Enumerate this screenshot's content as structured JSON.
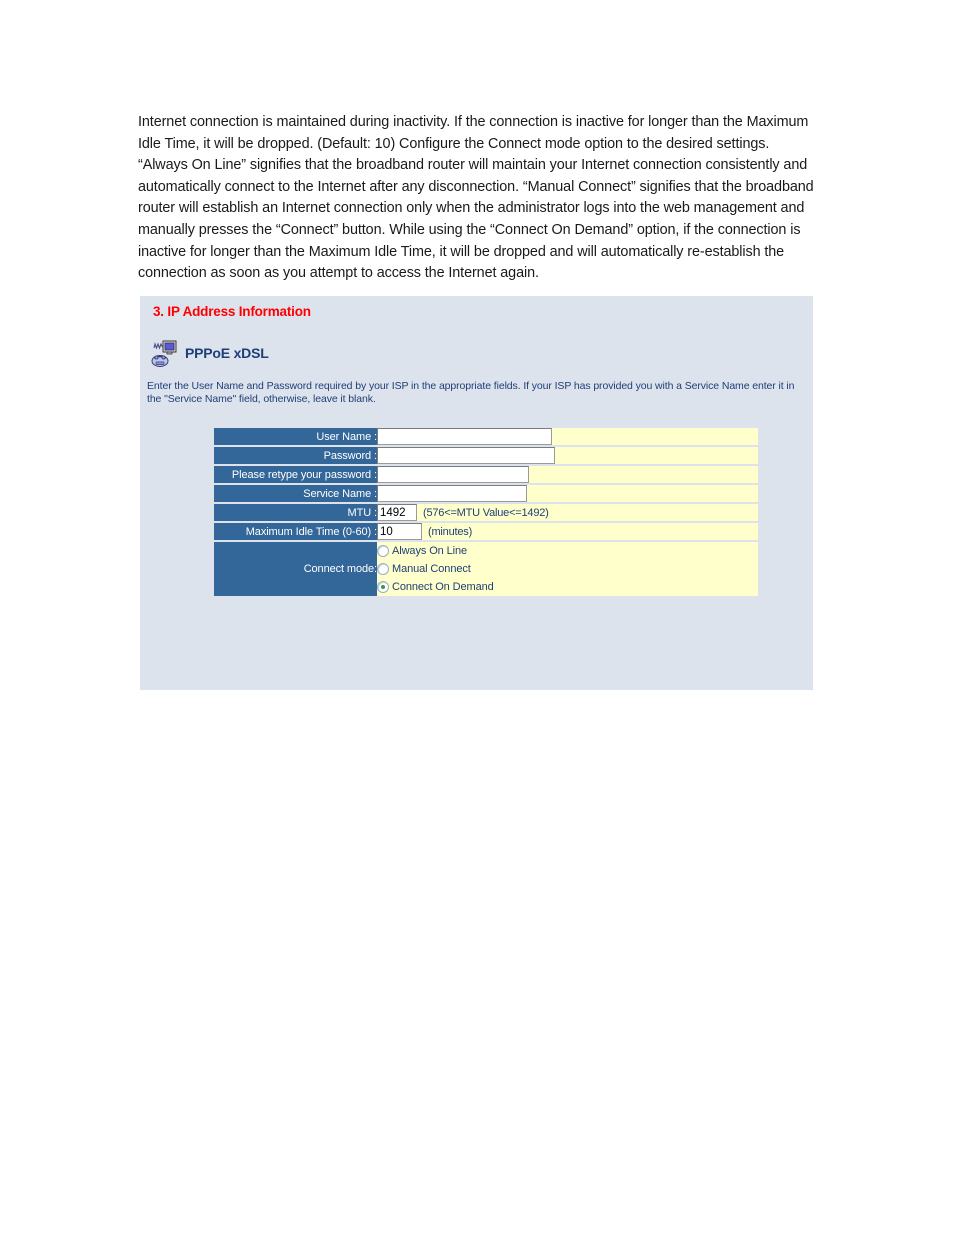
{
  "document": {
    "paragraph": "Internet connection is maintained during inactivity. If the connection is inactive for longer than the Maximum Idle Time, it will be dropped. (Default: 10) Configure the Connect mode option to the desired settings. “Always On Line” signifies that the broadband router will maintain your Internet connection consistently and automatically connect to the Internet after any disconnection. “Manual Connect” signifies that the broadband router will establish an Internet connection only when the administrator logs into the web management and manually presses the “Connect” button. While using the “Connect On Demand” option, if the connection is inactive for longer than the Maximum Idle Time, it will be dropped and will automatically re-establish the connection as soon as you attempt to access the Internet again."
  },
  "panel": {
    "title": "3. IP Address Information",
    "section_icon": "modem-computer-icon",
    "section_label": "PPPoE xDSL",
    "description": "Enter the User Name and Password required by your ISP in the appropriate fields. If your ISP has provided you with a Service Name enter it in the \"Service Name\" field, otherwise, leave it blank.",
    "colors": {
      "panel_background": "#dce3ec",
      "label_cell": "#336699",
      "value_cell": "#ffffcc",
      "title_text": "#ff0000",
      "section_text": "#1f3f77",
      "radio_selected_dot": "#3c9a3c"
    },
    "form": {
      "rows": [
        {
          "label": "User Name :",
          "value": "",
          "placeholder": ""
        },
        {
          "label": "Password :",
          "value": "",
          "placeholder": ""
        },
        {
          "label": "Please retype your password :",
          "value": "",
          "placeholder": ""
        },
        {
          "label": "Service Name :",
          "value": "",
          "placeholder": ""
        },
        {
          "label": "MTU :",
          "value": "1492",
          "hint": "(576<=MTU Value<=1492)"
        },
        {
          "label": "Maximum Idle Time (0-60) :",
          "value": "10",
          "hint": "(minutes)"
        }
      ],
      "connect_mode": {
        "label": "Connect mode:",
        "options": [
          {
            "label": "Always On Line",
            "selected": false
          },
          {
            "label": "Manual Connect",
            "selected": false
          },
          {
            "label": "Connect On Demand",
            "selected": true
          }
        ]
      }
    }
  }
}
